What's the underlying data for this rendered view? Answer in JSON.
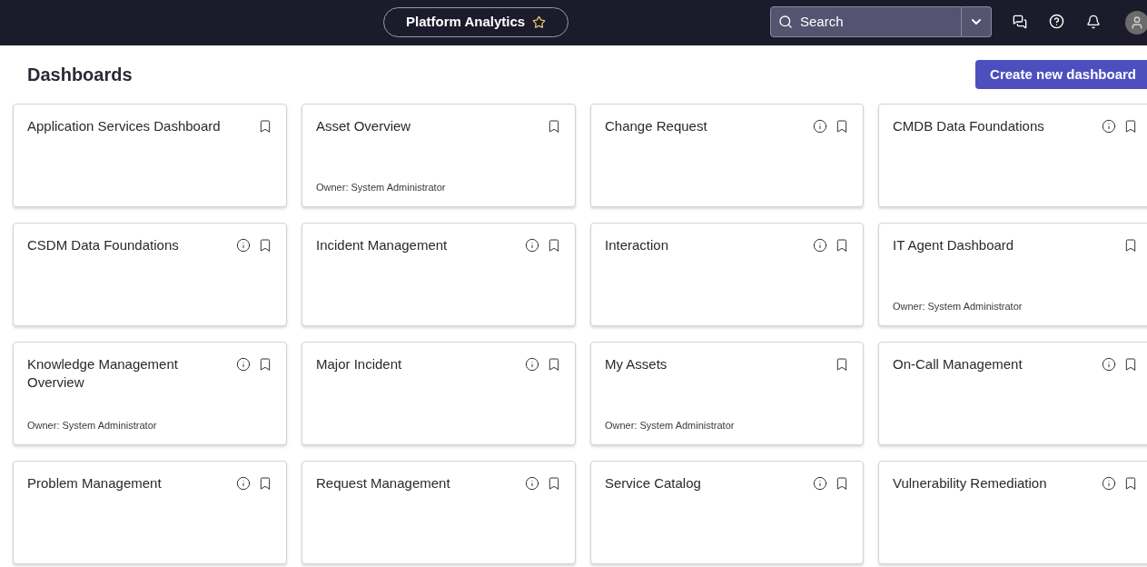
{
  "header": {
    "title": "Platform Analytics",
    "search": {
      "placeholder": "Search"
    }
  },
  "page": {
    "title": "Dashboards",
    "create_button": "Create new dashboard"
  },
  "dashboards": [
    {
      "title": "Application Services Dashboard",
      "info": false
    },
    {
      "title": "Asset Overview",
      "info": false,
      "owner": "Owner: System Administrator"
    },
    {
      "title": "Change Request",
      "info": true
    },
    {
      "title": "CMDB Data Foundations",
      "info": true
    },
    {
      "title": "CSDM Data Foundations",
      "info": true
    },
    {
      "title": "Incident Management",
      "info": true
    },
    {
      "title": "Interaction",
      "info": true
    },
    {
      "title": "IT Agent Dashboard",
      "info": false,
      "owner": "Owner: System Administrator"
    },
    {
      "title": "Knowledge Management Overview",
      "info": true,
      "owner": "Owner: System Administrator"
    },
    {
      "title": "Major Incident",
      "info": true
    },
    {
      "title": "My Assets",
      "info": false,
      "owner": "Owner: System Administrator"
    },
    {
      "title": "On-Call Management",
      "info": true
    },
    {
      "title": "Problem Management",
      "info": true
    },
    {
      "title": "Request Management",
      "info": true
    },
    {
      "title": "Service Catalog",
      "info": true
    },
    {
      "title": "Vulnerability Remediation",
      "info": true
    }
  ]
}
